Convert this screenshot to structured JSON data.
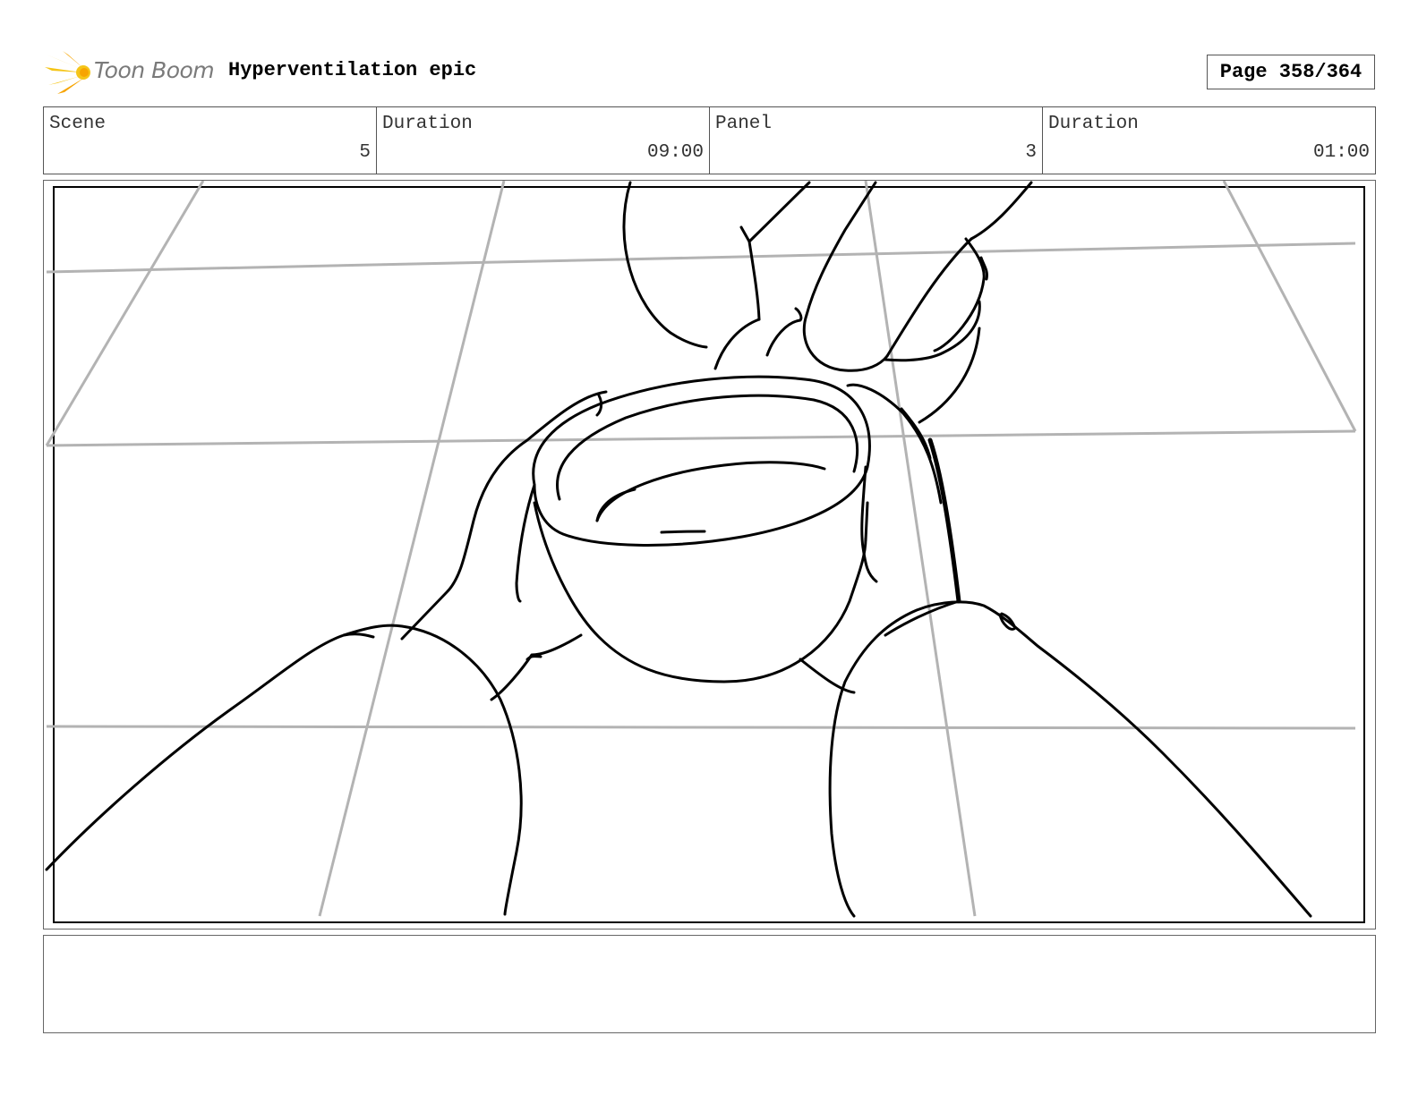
{
  "header": {
    "brand": "Toon Boom",
    "project_title": "Hyperventilation epic",
    "page_indicator": "Page 358/364"
  },
  "info": {
    "scene_label": "Scene",
    "scene_value": "5",
    "scene_duration_label": "Duration",
    "scene_duration_value": "09:00",
    "panel_label": "Panel",
    "panel_value": "3",
    "panel_duration_label": "Duration",
    "panel_duration_value": "01:00"
  },
  "colors": {
    "logo_primary": "#f5c518",
    "logo_secondary": "#f7a400",
    "sketch_line": "#000000",
    "guide_line": "#b3b3b3"
  },
  "caption": {
    "text": ""
  }
}
